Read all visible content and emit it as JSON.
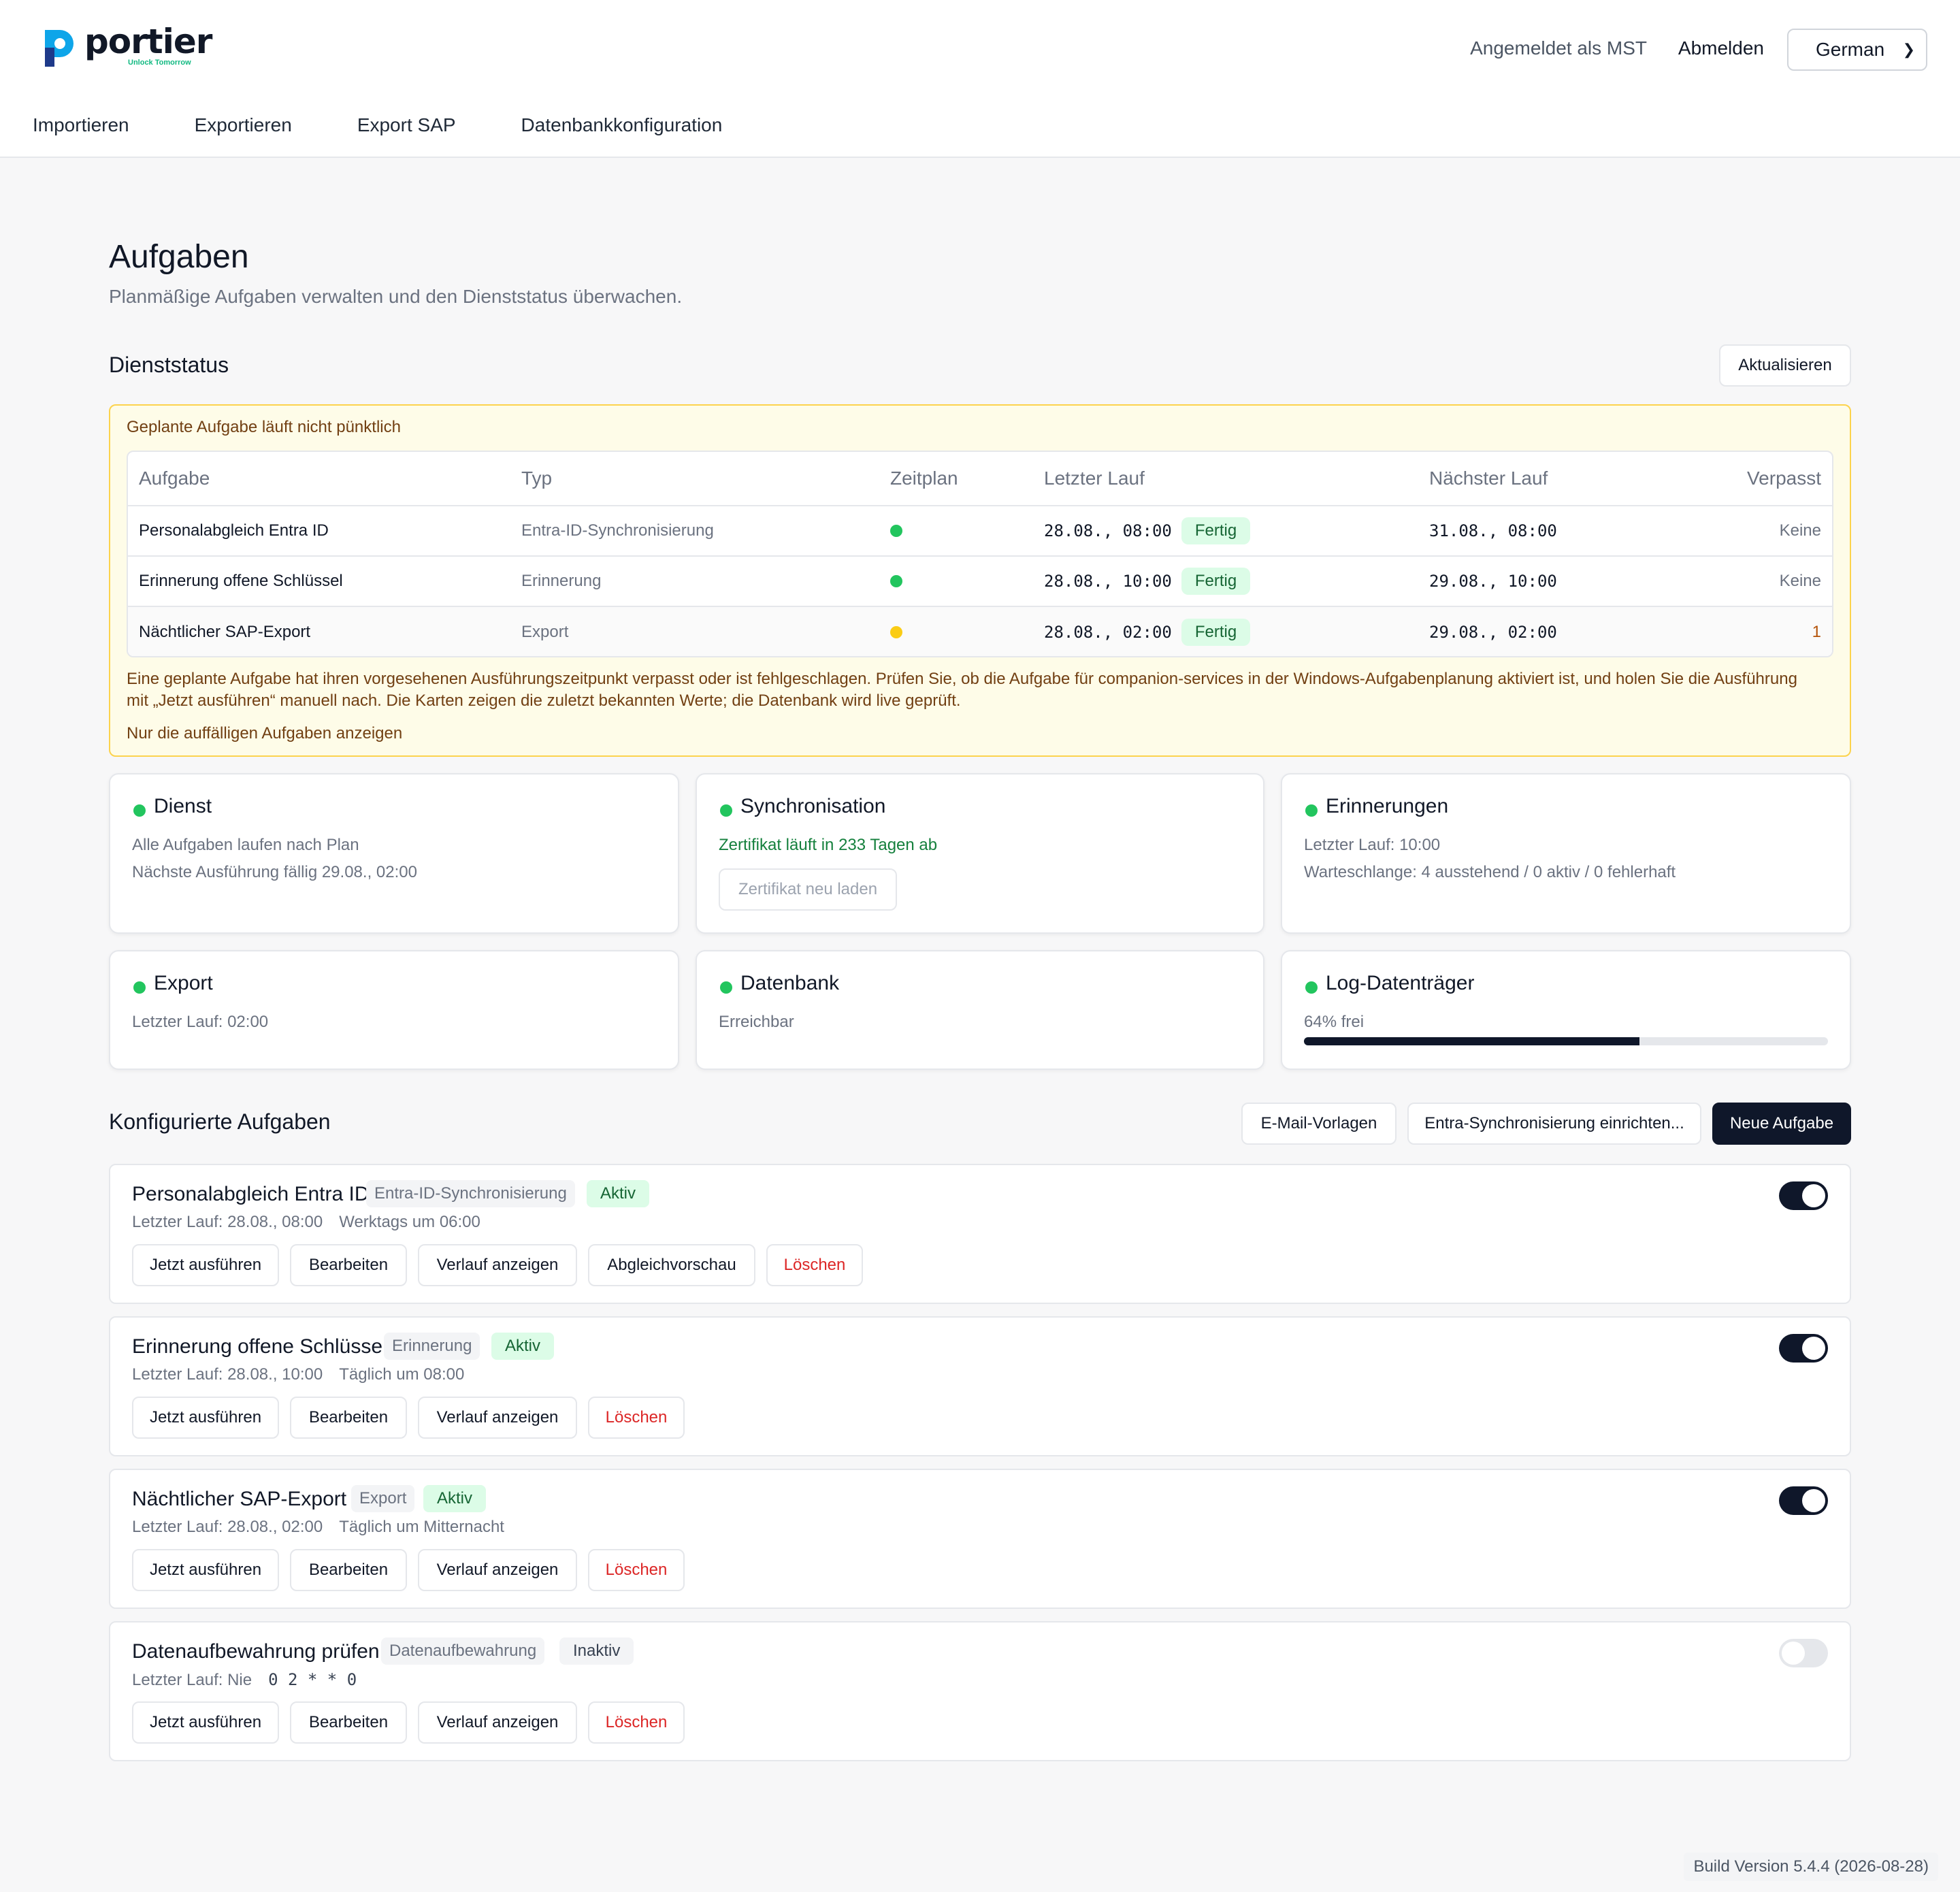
{
  "header": {
    "logo_text": "portier",
    "logo_tagline": "Unlock Tomorrow",
    "login_info": "Angemeldet als MST",
    "logout": "Abmelden",
    "language": "German"
  },
  "nav": [
    "Importieren",
    "Exportieren",
    "Export SAP",
    "Datenbankkonfiguration"
  ],
  "page": {
    "title": "Aufgaben",
    "subtitle": "Planmäßige Aufgaben verwalten und den Dienststatus überwachen."
  },
  "service_status": {
    "title": "Dienststatus",
    "refresh": "Aktualisieren"
  },
  "warning": {
    "title": "Geplante Aufgabe läuft nicht pünktlich",
    "columns": [
      "Aufgabe",
      "Typ",
      "Zeitplan",
      "Letzter Lauf",
      "Nächster Lauf",
      "Verpasst"
    ],
    "rows": [
      {
        "task": "Personalabgleich Entra ID",
        "type": "Entra-ID-Synchronisierung",
        "schedule_status": "green",
        "last_run": "28.08., 08:00",
        "last_status": "Fertig",
        "next_run": "31.08., 08:00",
        "missed": "Keine"
      },
      {
        "task": "Erinnerung offene Schlüssel",
        "type": "Erinnerung",
        "schedule_status": "green",
        "last_run": "28.08., 10:00",
        "last_status": "Fertig",
        "next_run": "29.08., 10:00",
        "missed": "Keine"
      },
      {
        "task": "Nächtlicher SAP-Export",
        "type": "Export",
        "schedule_status": "yellow",
        "last_run": "28.08., 02:00",
        "last_status": "Fertig",
        "next_run": "29.08., 02:00",
        "missed": "1"
      }
    ],
    "text_line1": "Eine geplante Aufgabe hat ihren vorgesehenen Ausführungszeitpunkt verpasst oder ist fehlgeschlagen. Prüfen Sie, ob die Aufgabe für companion-services in der Windows-Aufgabenplanung aktiviert ist, und holen Sie die Ausführung",
    "text_line2": "mit „Jetzt ausführen“ manuell nach. Die Karten zeigen die zuletzt bekannten Werte; die Datenbank wird live geprüft.",
    "filter_link": "Nur die auffälligen Aufgaben anzeigen"
  },
  "cards": {
    "dienst": {
      "title": "Dienst",
      "line1": "Alle Aufgaben laufen nach Plan",
      "line2": "Nächste Ausführung fällig 29.08., 02:00"
    },
    "sync": {
      "title": "Synchronisation",
      "line1": "Zertifikat läuft in 233 Tagen ab",
      "button": "Zertifikat neu laden"
    },
    "reminders": {
      "title": "Erinnerungen",
      "line1": "Letzter Lauf: 10:00",
      "line2": "Warteschlange: 4 ausstehend / 0 aktiv / 0 fehlerhaft"
    },
    "export": {
      "title": "Export",
      "line1": "Letzter Lauf: 02:00"
    },
    "database": {
      "title": "Datenbank",
      "line1": "Erreichbar"
    },
    "logdisk": {
      "title": "Log-Datenträger",
      "line1": "64% frei",
      "used_fraction": 0.64
    }
  },
  "configured": {
    "title": "Konfigurierte Aufgaben",
    "btn_templates": "E-Mail-Vorlagen",
    "btn_entra": "Entra-Synchronisierung einrichten...",
    "btn_new": "Neue Aufgabe"
  },
  "tasks": [
    {
      "name": "Personalabgleich Entra ID",
      "type": "Entra-ID-Synchronisierung",
      "status": "Aktiv",
      "last_run": "Letzter Lauf: 28.08., 08:00",
      "schedule": "Werktags um 06:00",
      "enabled": true,
      "buttons": [
        "Jetzt ausführen",
        "Bearbeiten",
        "Verlauf anzeigen",
        "Abgleichvorschau",
        "Löschen"
      ]
    },
    {
      "name": "Erinnerung offene Schlüssel",
      "type": "Erinnerung",
      "status": "Aktiv",
      "last_run": "Letzter Lauf: 28.08., 10:00",
      "schedule": "Täglich um 08:00",
      "enabled": true,
      "buttons": [
        "Jetzt ausführen",
        "Bearbeiten",
        "Verlauf anzeigen",
        "Löschen"
      ]
    },
    {
      "name": "Nächtlicher SAP-Export",
      "type": "Export",
      "status": "Aktiv",
      "last_run": "Letzter Lauf: 28.08., 02:00",
      "schedule": "Täglich um Mitternacht",
      "enabled": true,
      "buttons": [
        "Jetzt ausführen",
        "Bearbeiten",
        "Verlauf anzeigen",
        "Löschen"
      ]
    },
    {
      "name": "Datenaufbewahrung prüfen",
      "type": "Datenaufbewahrung",
      "status": "Inaktiv",
      "last_run": "Letzter Lauf: Nie",
      "schedule": "0 2 * * 0",
      "enabled": false,
      "buttons": [
        "Jetzt ausführen",
        "Bearbeiten",
        "Verlauf anzeigen",
        "Löschen"
      ]
    }
  ],
  "build": "Build Version 5.4.4 (2026-08-28)",
  "colors": {
    "accent_dark": "#0f172a",
    "ok_green": "#22c55e",
    "warn_yellow": "#facc15",
    "danger_red": "#dc2626"
  }
}
